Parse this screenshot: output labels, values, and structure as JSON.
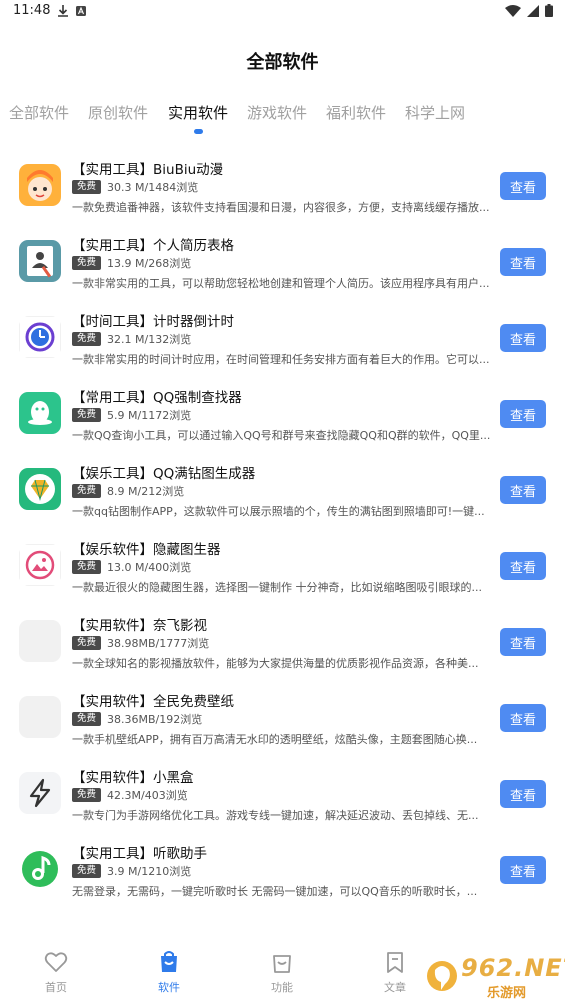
{
  "status_bar": {
    "time": "11:48"
  },
  "page_title": "全部软件",
  "tabs": [
    {
      "label": "全部软件",
      "active": false
    },
    {
      "label": "原创软件",
      "active": false
    },
    {
      "label": "实用软件",
      "active": true
    },
    {
      "label": "游戏软件",
      "active": false
    },
    {
      "label": "福利软件",
      "active": false
    },
    {
      "label": "科学上网",
      "active": false
    }
  ],
  "items": [
    {
      "title": "【实用工具】BiuBiu动漫",
      "badge": "免费",
      "meta": "30.3 M/1484浏览",
      "desc": "一款免费追番神器，该软件支持看国漫和日漫，内容很多，方便，支持离线缓存播放...",
      "button": "查看",
      "icon": "anime-app-icon"
    },
    {
      "title": "【实用工具】个人简历表格",
      "badge": "免费",
      "meta": "13.9 M/268浏览",
      "desc": "一款非常实用的工具，可以帮助您轻松地创建和管理个人简历。该应用程序具有用户...",
      "button": "查看",
      "icon": "resume-app-icon"
    },
    {
      "title": "【时间工具】计时器倒计时",
      "badge": "免费",
      "meta": "32.1 M/132浏览",
      "desc": "一款非常实用的时间计时应用，在时间管理和任务安排方面有着巨大的作用。它可以...",
      "button": "查看",
      "icon": "timer-app-icon"
    },
    {
      "title": "【常用工具】QQ强制查找器",
      "badge": "免费",
      "meta": "5.9 M/1172浏览",
      "desc": "一款QQ查询小工具，可以通过输入QQ号和群号来查找隐藏QQ和Q群的软件，QQ里...",
      "button": "查看",
      "icon": "qq-finder-app-icon"
    },
    {
      "title": "【娱乐工具】QQ满钻图生成器",
      "badge": "免费",
      "meta": "8.9 M/212浏览",
      "desc": "一款qq钻图制作APP，这款软件可以展示照墙的个，传生的满钻图到照墙即可!一键...",
      "button": "查看",
      "icon": "diamond-app-icon"
    },
    {
      "title": "【娱乐软件】隐藏图生器",
      "badge": "免费",
      "meta": "13.0 M/400浏览",
      "desc": "一款最近很火的隐藏图生器，选择图一键制作 十分神奇，比如说缩略图吸引眼球的...",
      "button": "查看",
      "icon": "hidden-image-app-icon"
    },
    {
      "title": "【实用软件】奈飞影视",
      "badge": "免费",
      "meta": "38.98MB/1777浏览",
      "desc": "一款全球知名的影视播放软件，能够为大家提供海量的优质影视作品资源，各种美...",
      "button": "查看",
      "icon": "blank-app-icon"
    },
    {
      "title": "【实用软件】全民免费壁纸",
      "badge": "免费",
      "meta": "38.36MB/192浏览",
      "desc": "一款手机壁纸APP，拥有百万高清无水印的透明壁纸，炫酷头像，主题套图随心换...",
      "button": "查看",
      "icon": "blank-app-icon"
    },
    {
      "title": "【实用软件】小黑盒",
      "badge": "免费",
      "meta": "42.3M/403浏览",
      "desc": "一款专门为手游网络优化工具。游戏专线一键加速，解决延迟波动、丢包掉线、无...",
      "button": "查看",
      "icon": "lightning-app-icon"
    },
    {
      "title": "【实用工具】听歌助手",
      "badge": "免费",
      "meta": "3.9 M/1210浏览",
      "desc": "无需登录，无需码，一键完听歌时长 无需码一键加速，可以QQ音乐的听歌时长，...",
      "button": "查看",
      "icon": "music-app-icon"
    }
  ],
  "bottom_nav": [
    {
      "label": "首页",
      "icon": "heart-icon",
      "active": false
    },
    {
      "label": "软件",
      "icon": "bag-icon",
      "active": true
    },
    {
      "label": "功能",
      "icon": "bag-outline-icon",
      "active": false
    },
    {
      "label": "文章",
      "icon": "bookmark-icon",
      "active": false
    }
  ],
  "watermark": {
    "logo": "962.NET",
    "sub": "乐游网"
  },
  "colors": {
    "accent": "#2f7bea",
    "button": "#4f8bf2",
    "badge": "#4a4a4a"
  }
}
